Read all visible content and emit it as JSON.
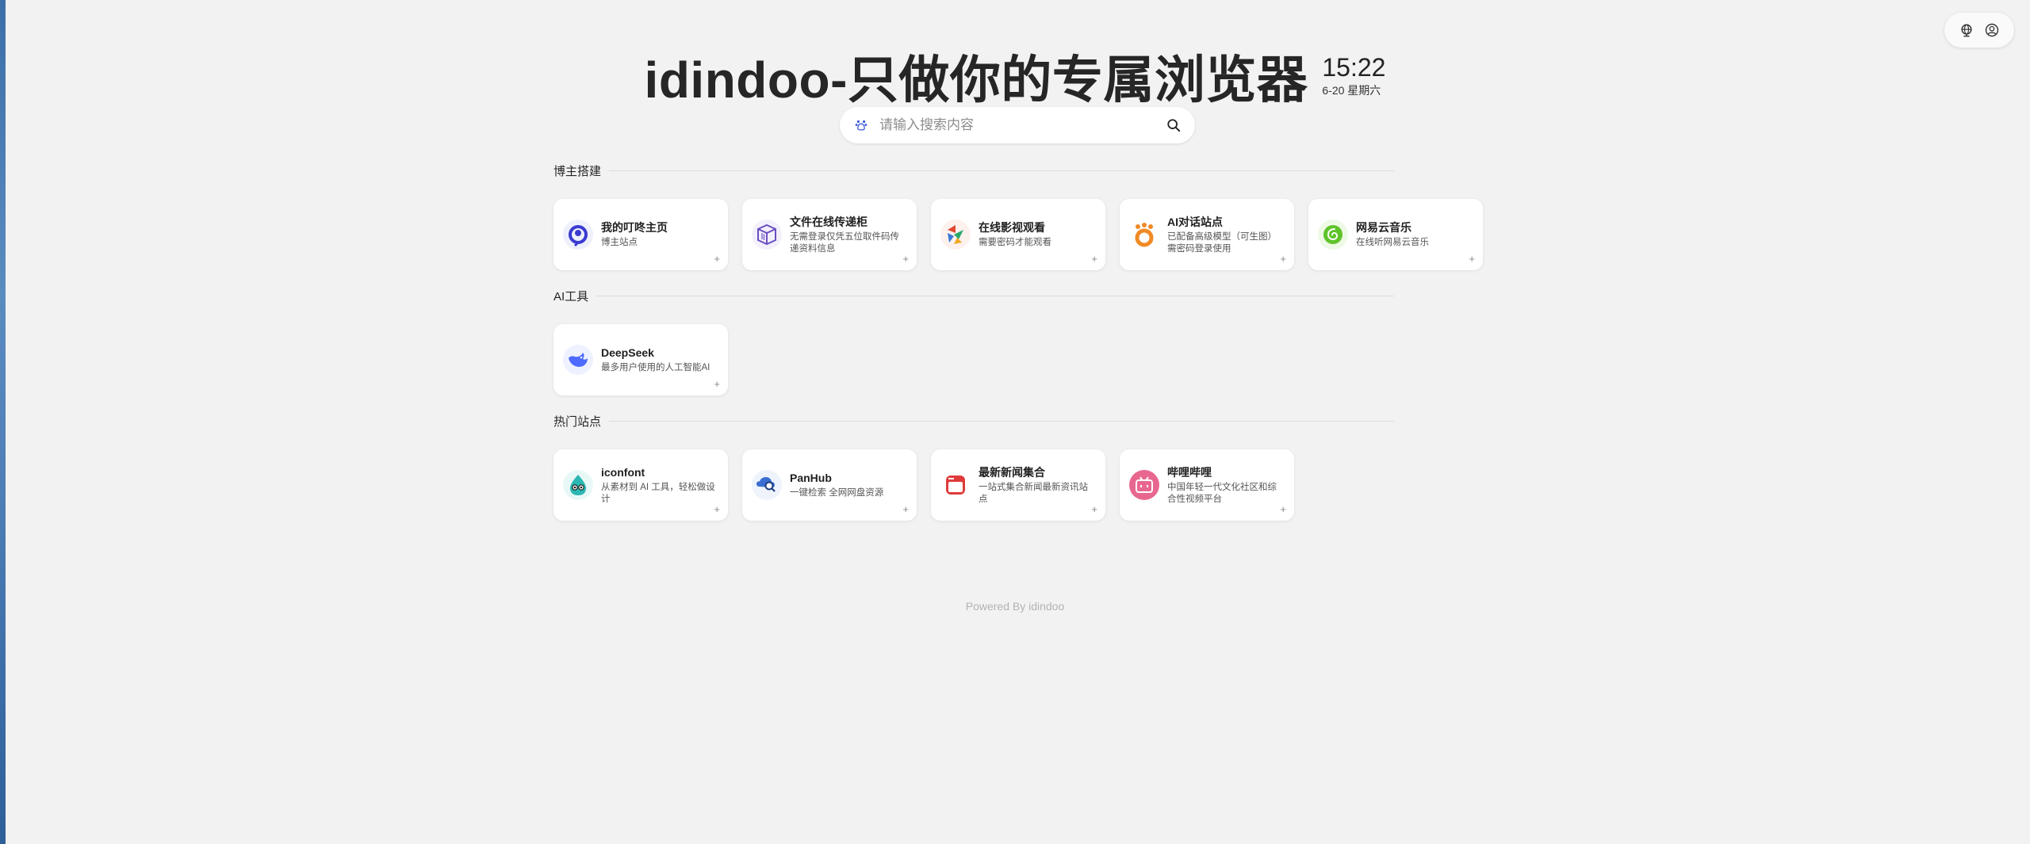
{
  "header": {
    "title": "idindoo-只做你的专属浏览器",
    "time": "15:22",
    "date": "6-20 星期六"
  },
  "top_controls": {
    "icons": [
      "globe-icon",
      "user-icon"
    ]
  },
  "search": {
    "placeholder": "请输入搜索内容",
    "engine_icon": "baidu-paw-icon",
    "button_icon": "search-icon"
  },
  "sections": [
    {
      "title": "博主搭建",
      "cards": [
        {
          "name": "我的叮咚主页",
          "desc": "博主站点",
          "icon": "dingdong-logo-icon",
          "color": "#3b3bd1"
        },
        {
          "name": "文件在线传递柜",
          "desc": "无需登录仅凭五位取件码传递资料信息",
          "icon": "box-logo-icon",
          "color": "#6a4fc2"
        },
        {
          "name": "在线影视观看",
          "desc": "需要密码才能观看",
          "icon": "movie-logo-icon",
          "color": "#e0492f"
        },
        {
          "name": "AI对话站点",
          "desc": "已配备高级模型（可生图） 需密码登录使用",
          "icon": "ai-chat-logo-icon",
          "color": "#f08a24"
        },
        {
          "name": "网易云音乐",
          "desc": "在线听网易云音乐",
          "icon": "netease-music-logo-icon",
          "color": "#5fc42a"
        }
      ]
    },
    {
      "title": "AI工具",
      "cards": [
        {
          "name": "DeepSeek",
          "desc": "最多用户使用的人工智能AI",
          "icon": "deepseek-logo-icon",
          "color": "#4d6bfe"
        }
      ]
    },
    {
      "title": "热门站点",
      "cards": [
        {
          "name": "iconfont",
          "desc": "从素材到 AI 工具，轻松做设计",
          "icon": "iconfont-logo-icon",
          "color": "#2bb7b3"
        },
        {
          "name": "PanHub",
          "desc": "一键检索 全网网盘资源",
          "icon": "panhub-logo-icon",
          "color": "#3a6ed1"
        },
        {
          "name": "最新新闻集合",
          "desc": "一站式集合新闻最新资讯站点",
          "icon": "news-logo-icon",
          "color": "#e03a3a"
        },
        {
          "name": "哔哩哔哩",
          "desc": "中国年轻一代文化社区和综合性视频平台",
          "icon": "bilibili-logo-icon",
          "color": "#e8678f"
        }
      ]
    }
  ],
  "card_action_symbol": "+",
  "footer": "Powered By idindoo"
}
